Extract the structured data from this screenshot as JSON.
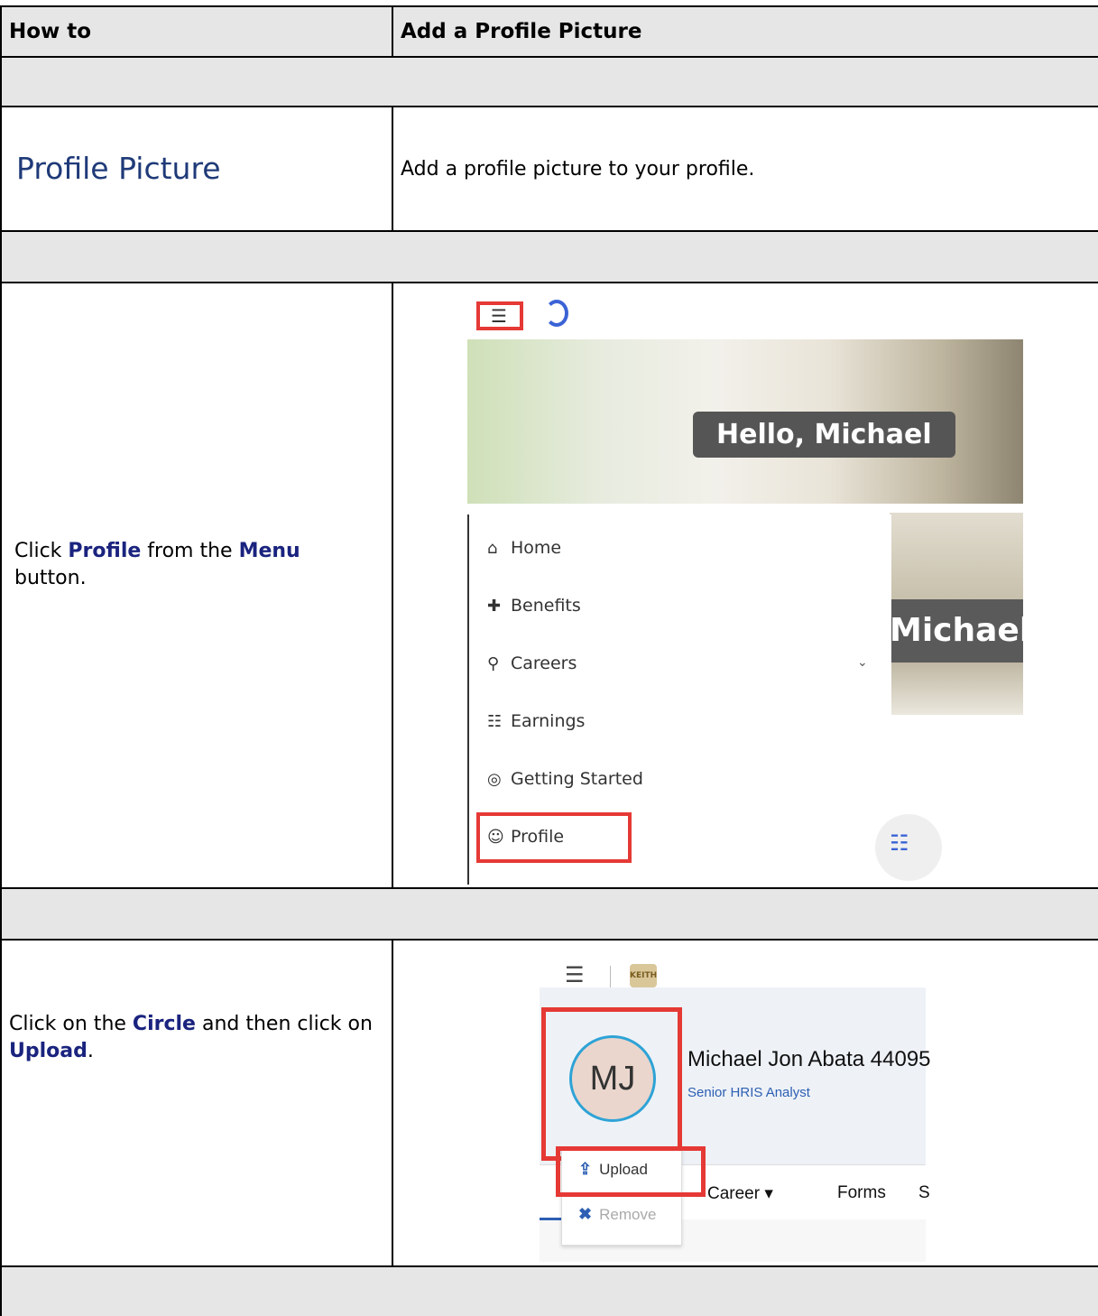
{
  "header": {
    "col1": "How to",
    "col2": "Add a Profile Picture"
  },
  "title_row": {
    "title": "Profile Picture",
    "description": "Add a profile picture to your profile."
  },
  "step1": {
    "text_parts": [
      "Click ",
      "Profile",
      " from the ",
      "Menu",
      " button."
    ],
    "screenshot": {
      "greeting": "Hello, Michael",
      "greeting_partial": "Michael",
      "menu_items": [
        {
          "label": "Home",
          "icon": "home-icon",
          "glyph": "⌂"
        },
        {
          "label": "Benefits",
          "icon": "plus-circle-icon",
          "glyph": "✚"
        },
        {
          "label": "Careers",
          "icon": "career-search-icon",
          "glyph": "⚲"
        },
        {
          "label": "Earnings",
          "icon": "earnings-icon",
          "glyph": "☷"
        },
        {
          "label": "Getting Started",
          "icon": "compass-icon",
          "glyph": "◎"
        },
        {
          "label": "Profile",
          "icon": "user-circle-icon",
          "glyph": "☺"
        }
      ]
    }
  },
  "step2": {
    "text_parts": [
      " Click on the ",
      "Circle",
      " and then click on ",
      "Upload",
      "."
    ],
    "screenshot": {
      "initials": "MJ",
      "name": "Michael Jon Abata 44095",
      "job_title": "Senior HRIS Analyst",
      "tabs": [
        "Career ▾",
        "Forms",
        "S"
      ],
      "menu": {
        "upload": "Upload",
        "remove": "Remove"
      },
      "logo_text": "KEITH"
    }
  },
  "colors": {
    "gray_band": "#e6e6e6",
    "highlight": "#1a237e",
    "title": "#1f3a78",
    "callout": "#e53935"
  }
}
